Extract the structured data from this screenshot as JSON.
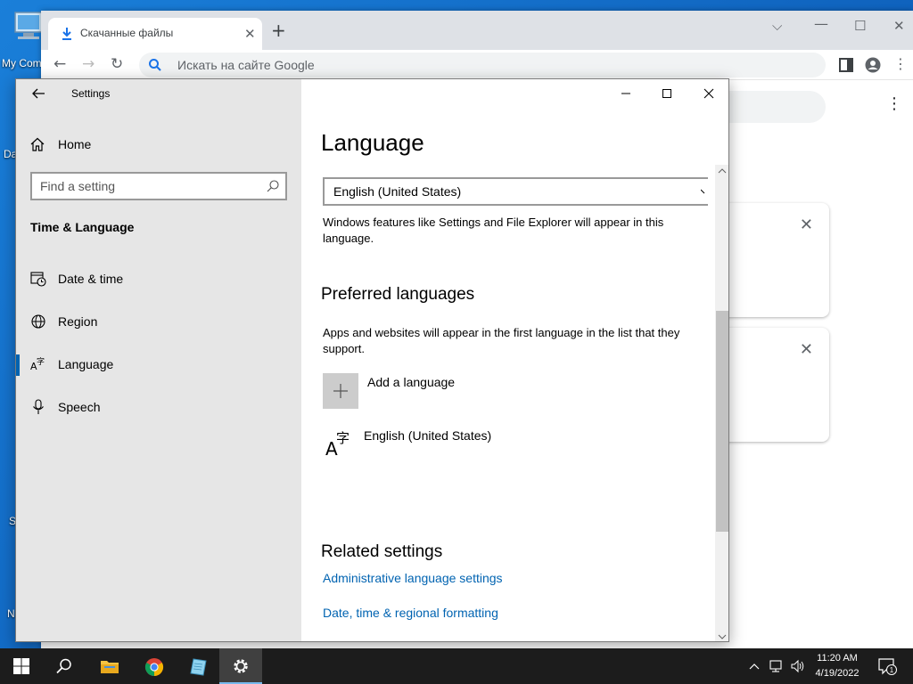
{
  "desktop": {
    "icon_label": "My Com",
    "fragments": [
      "Da",
      "S",
      "N"
    ]
  },
  "chrome": {
    "tab_title": "Скачанные файлы",
    "omnibox_placeholder": "Искать на сайте Google"
  },
  "settings": {
    "app_title": "Settings",
    "home_label": "Home",
    "search_placeholder": "Find a setting",
    "category": "Time & Language",
    "nav": [
      {
        "label": "Date & time",
        "icon": "calendar-clock-icon"
      },
      {
        "label": "Region",
        "icon": "globe-icon"
      },
      {
        "label": "Language",
        "icon": "language-icon",
        "active": true
      },
      {
        "label": "Speech",
        "icon": "microphone-icon"
      }
    ],
    "main": {
      "title": "Language",
      "display_language": "English (United States)",
      "display_language_desc": "Windows features like Settings and File Explorer will appear in this language.",
      "preferred_title": "Preferred languages",
      "preferred_desc": "Apps and websites will appear in the first language in the list that they support.",
      "add_language": "Add a language",
      "languages": [
        "English (United States)"
      ],
      "related_title": "Related settings",
      "links": [
        "Administrative language settings",
        "Date, time & regional formatting"
      ]
    }
  },
  "taskbar": {
    "time": "11:20 AM",
    "date": "4/19/2022",
    "notification_count": "1"
  },
  "colors": {
    "accent": "#0063b1",
    "sidebar_bg": "#e6e6e6",
    "taskbar_bg": "#1c1c1c"
  }
}
